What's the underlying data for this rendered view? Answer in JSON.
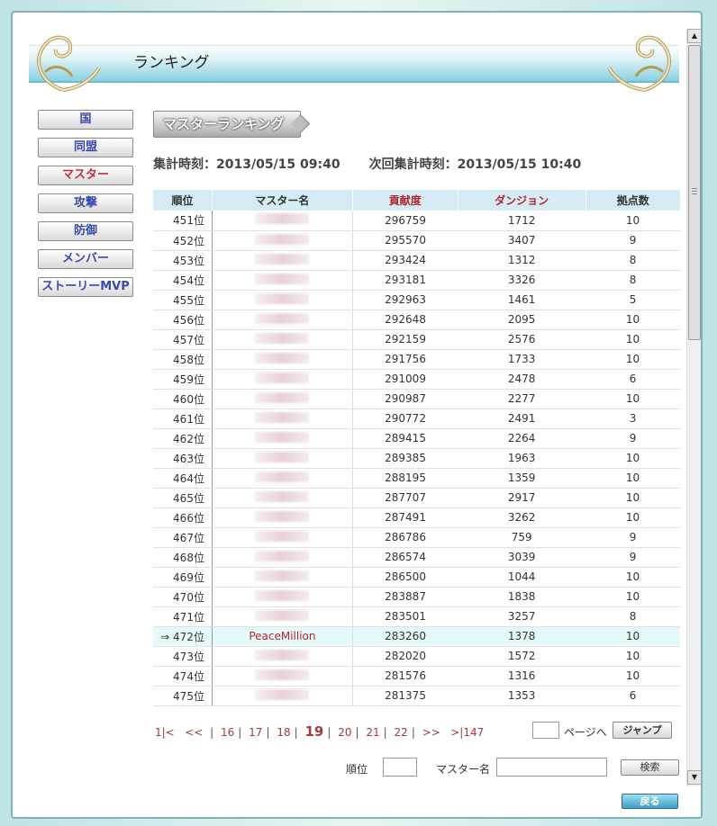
{
  "window": {
    "title": "ランキング"
  },
  "nav": [
    "国",
    "同盟",
    "マスター",
    "攻撃",
    "防御",
    "メンバー",
    "ストーリーMVP"
  ],
  "nav_active": "マスター",
  "section_badge": "マスターランキング",
  "times": {
    "current": "集計時刻：2013/05/15 09:40",
    "next": "次回集計時刻：2013/05/15 10:40"
  },
  "table": {
    "headers": [
      "順位",
      "マスター名",
      "貢献度",
      "ダンジョン",
      "拠点数"
    ],
    "rows": [
      {
        "rank": "451位",
        "name": "",
        "contribution": "296759",
        "dungeon": "1712",
        "bases": "10"
      },
      {
        "rank": "452位",
        "name": "",
        "contribution": "295570",
        "dungeon": "3407",
        "bases": "9"
      },
      {
        "rank": "453位",
        "name": "",
        "contribution": "293424",
        "dungeon": "1312",
        "bases": "8"
      },
      {
        "rank": "454位",
        "name": "",
        "contribution": "293181",
        "dungeon": "3326",
        "bases": "8"
      },
      {
        "rank": "455位",
        "name": "",
        "contribution": "292963",
        "dungeon": "1461",
        "bases": "5"
      },
      {
        "rank": "456位",
        "name": "",
        "contribution": "292648",
        "dungeon": "2095",
        "bases": "10"
      },
      {
        "rank": "457位",
        "name": "",
        "contribution": "292159",
        "dungeon": "2576",
        "bases": "10"
      },
      {
        "rank": "458位",
        "name": "",
        "contribution": "291756",
        "dungeon": "1733",
        "bases": "10"
      },
      {
        "rank": "459位",
        "name": "",
        "contribution": "291009",
        "dungeon": "2478",
        "bases": "6"
      },
      {
        "rank": "460位",
        "name": "",
        "contribution": "290987",
        "dungeon": "2277",
        "bases": "10"
      },
      {
        "rank": "461位",
        "name": "",
        "contribution": "290772",
        "dungeon": "2491",
        "bases": "3"
      },
      {
        "rank": "462位",
        "name": "",
        "contribution": "289415",
        "dungeon": "2264",
        "bases": "9"
      },
      {
        "rank": "463位",
        "name": "",
        "contribution": "289385",
        "dungeon": "1963",
        "bases": "10"
      },
      {
        "rank": "464位",
        "name": "",
        "contribution": "288195",
        "dungeon": "1359",
        "bases": "10"
      },
      {
        "rank": "465位",
        "name": "",
        "contribution": "287707",
        "dungeon": "2917",
        "bases": "10"
      },
      {
        "rank": "466位",
        "name": "",
        "contribution": "287491",
        "dungeon": "3262",
        "bases": "10"
      },
      {
        "rank": "467位",
        "name": "",
        "contribution": "286786",
        "dungeon": "759",
        "bases": "9"
      },
      {
        "rank": "468位",
        "name": "",
        "contribution": "286574",
        "dungeon": "3039",
        "bases": "9"
      },
      {
        "rank": "469位",
        "name": "",
        "contribution": "286500",
        "dungeon": "1044",
        "bases": "10"
      },
      {
        "rank": "470位",
        "name": "",
        "contribution": "283887",
        "dungeon": "1838",
        "bases": "10"
      },
      {
        "rank": "471位",
        "name": "",
        "contribution": "283501",
        "dungeon": "3257",
        "bases": "8"
      },
      {
        "rank": "⇒ 472位",
        "name": "PeaceMillion",
        "contribution": "283260",
        "dungeon": "1378",
        "bases": "10",
        "me": true
      },
      {
        "rank": "473位",
        "name": "",
        "contribution": "282020",
        "dungeon": "1572",
        "bases": "10"
      },
      {
        "rank": "474位",
        "name": "",
        "contribution": "281576",
        "dungeon": "1316",
        "bases": "10"
      },
      {
        "rank": "475位",
        "name": "",
        "contribution": "281375",
        "dungeon": "1353",
        "bases": "6"
      }
    ]
  },
  "pager": {
    "first": "1|<",
    "prev": "<<",
    "pages": [
      "16",
      "17",
      "18",
      "19",
      "20",
      "21",
      "22"
    ],
    "current": "19",
    "next": ">>",
    "last": ">|147",
    "page_suffix": "ページへ",
    "jump_label": "ジャンプ"
  },
  "search": {
    "rank_label": "順位",
    "name_label": "マスター名",
    "button": "検索"
  },
  "back_label": "戻る",
  "colors": {
    "accent_red": "#b3262e",
    "header_blue": "#d6ecf5",
    "nav_text": "#3a4aa8"
  }
}
